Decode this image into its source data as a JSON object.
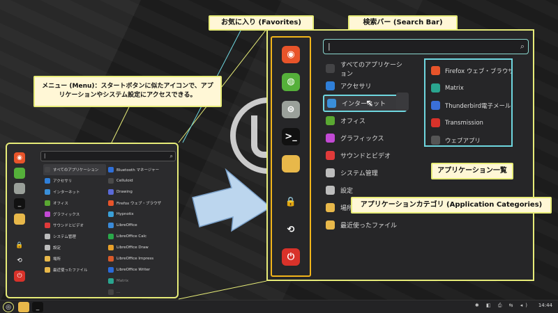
{
  "callouts": {
    "menu": "メニュー (Menu)：スタートボタンに似たアイコンで、アプリケーションやシステム設定にアクセスできる。",
    "favorites": "お気に入り (Favorites)",
    "search_bar": "検索バー (Search Bar)",
    "app_list": "アプリケーション一覧",
    "app_categories": "アプリケーションカテゴリ (Application Categories)"
  },
  "search": {
    "value": "|",
    "icon": "search-icon"
  },
  "categories": [
    {
      "label": "すべてのアプリケーション",
      "icon": "grid-icon",
      "color": "#444446"
    },
    {
      "label": "アクセサリ",
      "icon": "accessories-icon",
      "color": "#2f7fd8"
    },
    {
      "label": "インターネット",
      "icon": "cloud-icon",
      "color": "#3a8fd9"
    },
    {
      "label": "オフィス",
      "icon": "office-icon",
      "color": "#5aa832"
    },
    {
      "label": "グラフィックス",
      "icon": "graphics-icon",
      "color": "#c249d4"
    },
    {
      "label": "サウンドとビデオ",
      "icon": "media-icon",
      "color": "#e03a3a"
    },
    {
      "label": "システム管理",
      "icon": "settings-icon",
      "color": "#bdbdbd"
    },
    {
      "label": "設定",
      "icon": "preferences-icon",
      "color": "#bdbdbd"
    },
    {
      "label": "場所",
      "icon": "folder-icon",
      "color": "#e8b84a"
    },
    {
      "label": "最近使ったファイル",
      "icon": "recent-icon",
      "color": "#e8b84a"
    }
  ],
  "big_apps": [
    {
      "label": "Firefox ウェブ・ブラウザ",
      "icon": "firefox-icon",
      "color": "#e8542a"
    },
    {
      "label": "Matrix",
      "icon": "matrix-icon",
      "color": "#2aa58f"
    },
    {
      "label": "Thunderbird電子メール...",
      "icon": "mail-icon",
      "color": "#3a6fd8"
    },
    {
      "label": "Transmission",
      "icon": "transmission-icon",
      "color": "#d8322a"
    },
    {
      "label": "ウェブアプリ",
      "icon": "webapp-icon",
      "color": "#555"
    }
  ],
  "mini_apps": [
    {
      "label": "Bluetooth マネージャー",
      "color": "#2f6fd8",
      "dim": false
    },
    {
      "label": "Celluloid",
      "color": "#4a4a4a",
      "dim": false
    },
    {
      "label": "Drawing",
      "color": "#5a6ad8",
      "dim": false
    },
    {
      "label": "Firefox ウェブ・ブラウザ",
      "color": "#e8542a",
      "dim": false
    },
    {
      "label": "Hypnotix",
      "color": "#3aa0d8",
      "dim": false
    },
    {
      "label": "LibreOffice",
      "color": "#3a8ad8",
      "dim": false
    },
    {
      "label": "LibreOffice Calc",
      "color": "#2aa84a",
      "dim": false
    },
    {
      "label": "LibreOffice Draw",
      "color": "#e8a02a",
      "dim": false
    },
    {
      "label": "LibreOffice Impress",
      "color": "#d85a2a",
      "dim": false
    },
    {
      "label": "LibreOffice Writer",
      "color": "#2a6ad8",
      "dim": false
    },
    {
      "label": "Matrix",
      "color": "#2aa58f",
      "dim": true
    },
    {
      "label": "...",
      "color": "#444",
      "dim": true
    }
  ],
  "favorites": [
    {
      "icon": "firefox-icon",
      "color": "#e8542a",
      "glyph": "◉"
    },
    {
      "icon": "web-icon",
      "color": "#55b03a",
      "glyph": "◍"
    },
    {
      "icon": "toggle-settings-icon",
      "color": "#9aa09a",
      "glyph": "⊜"
    },
    {
      "icon": "terminal-icon",
      "color": "#111",
      "glyph": ">_"
    },
    {
      "icon": "folder-icon",
      "color": "#e8b84a",
      "glyph": ""
    },
    {
      "icon": "lock-icon",
      "color": "transparent",
      "glyph": "🔒"
    },
    {
      "icon": "logout-icon",
      "color": "transparent",
      "glyph": "⟲"
    },
    {
      "icon": "power-icon",
      "color": "#d8322a",
      "glyph": "⏻"
    }
  ],
  "taskbar": {
    "clock": "14:44"
  },
  "colors": {
    "highlight_yellow": "#e7ec78",
    "highlight_cyan": "#6fd7e0",
    "fav_orange": "#f2b51a"
  }
}
